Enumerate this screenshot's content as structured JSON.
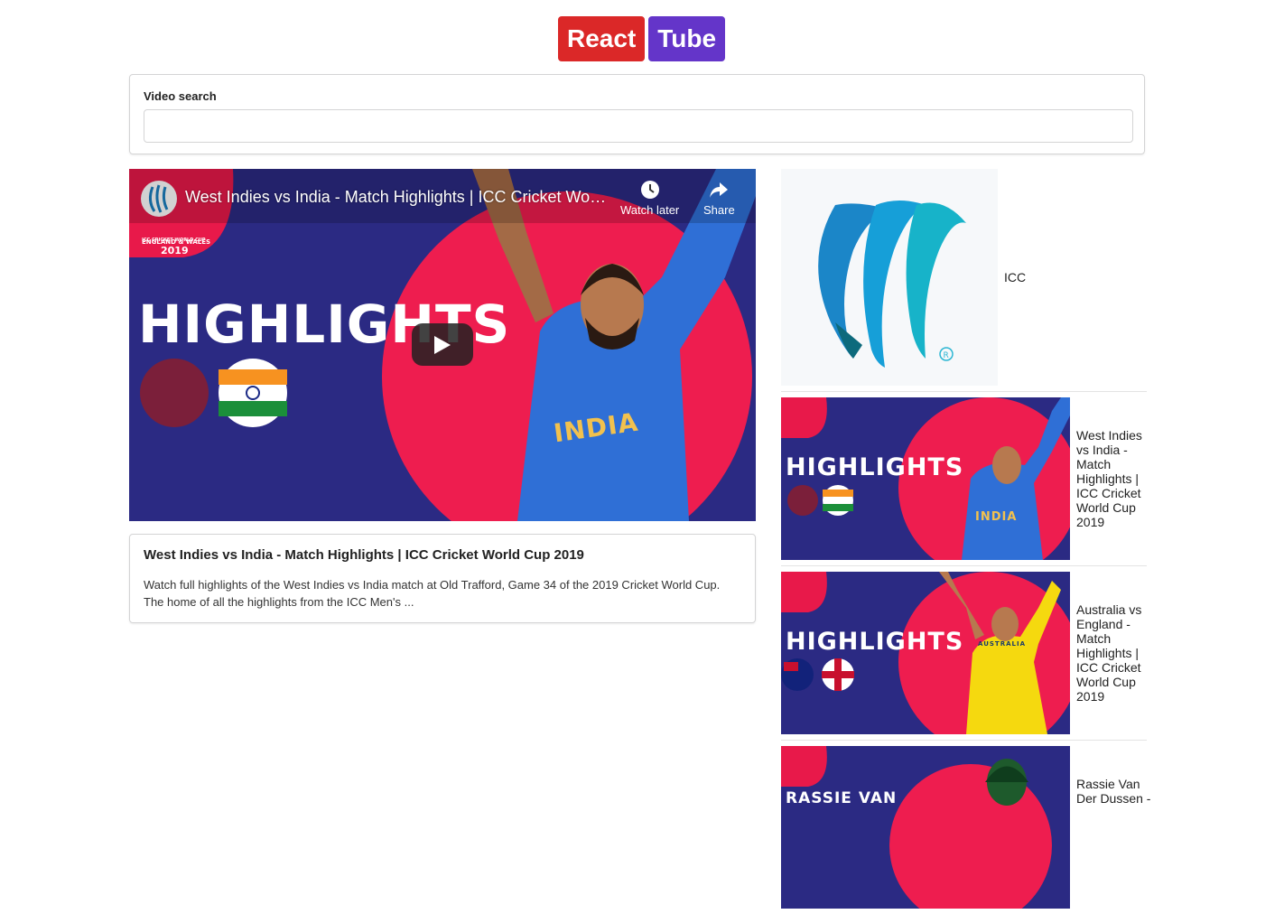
{
  "brand": {
    "part1": "React",
    "part2": "Tube",
    "colors": {
      "react": "#db2828",
      "tube": "#6435c9"
    }
  },
  "search": {
    "label": "Video search",
    "value": "",
    "placeholder": ""
  },
  "player": {
    "title": "West Indies vs India - Match Highlights | ICC Cricket Worl...",
    "watch_later": "Watch later",
    "share": "Share",
    "overlay_text": "HIGHLIGHTS",
    "badge_line1": "ICC CRICKET WORLD CUP",
    "badge_line2": "ENGLAND & WALES",
    "badge_line3": "2019",
    "jersey_text": "INDIA"
  },
  "selected": {
    "title": "West Indies vs India - Match Highlights | ICC Cricket World Cup 2019",
    "description": "Watch full highlights of the West Indies vs India match at Old Trafford, Game 34 of the 2019 Cricket World Cup. The home of all the highlights from the ICC Men's ..."
  },
  "results": [
    {
      "title": "ICC",
      "thumb": "icc-logo"
    },
    {
      "title": "West Indies vs India - Match Highlights | ICC Cricket World Cup 2019",
      "thumb": "highlights-wi-ind",
      "overlay": "HIGHLIGHTS",
      "jersey": "INDIA"
    },
    {
      "title": "Australia vs England - Match Highlights | ICC Cricket World Cup 2019",
      "thumb": "highlights-aus-eng",
      "overlay": "HIGHLIGHTS",
      "jersey": "AUSTRALIA"
    },
    {
      "title": "Rassie Van Der Dussen -",
      "thumb": "rassie",
      "overlay": "RASSIE VAN"
    }
  ]
}
